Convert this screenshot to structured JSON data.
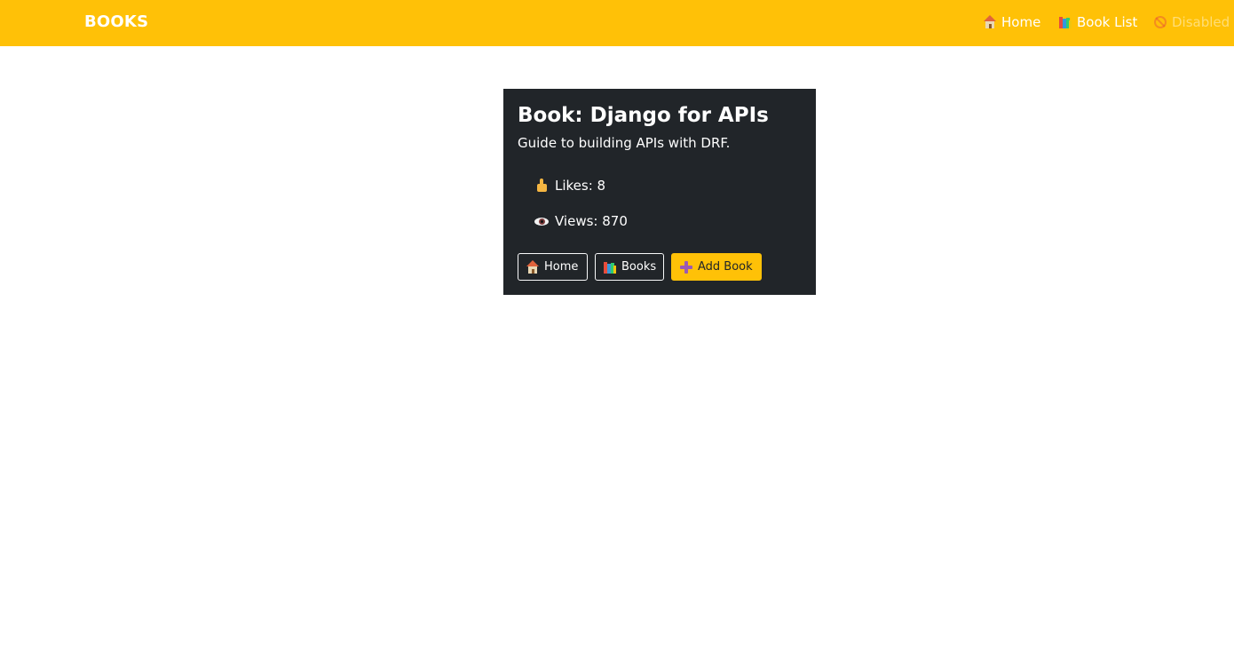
{
  "navbar": {
    "brand": "BOOKS",
    "links": [
      {
        "label": "Home",
        "icon": "house-icon",
        "disabled": false
      },
      {
        "label": "Book List",
        "icon": "books-icon",
        "disabled": false
      },
      {
        "label": "Disabled",
        "icon": "prohibited-icon",
        "disabled": true
      }
    ],
    "color": "#ffc107"
  },
  "card": {
    "title": "Book: Django for APIs",
    "description": "Guide to building APIs with DRF.",
    "stats": [
      {
        "label": "Likes: 8",
        "icon": "thumbs-up-icon"
      },
      {
        "label": "Views: 870",
        "icon": "eye-icon"
      }
    ],
    "buttons": [
      {
        "label": "Home",
        "icon": "house-icon",
        "style": "outline"
      },
      {
        "label": "Books",
        "icon": "books-icon",
        "style": "outline"
      },
      {
        "label": "Add Book",
        "icon": "plus-icon",
        "style": "warning"
      }
    ],
    "background": "#212529"
  }
}
